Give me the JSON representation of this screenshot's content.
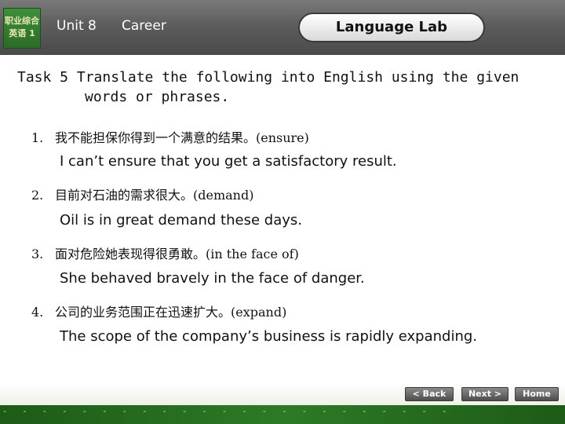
{
  "header": {
    "logo_lines": [
      "职业综合",
      "英语 1"
    ],
    "unit": "Unit 8",
    "career": "Career",
    "section": "Language Lab"
  },
  "task": {
    "line1": "Task 5 Translate the following into English using the given",
    "line2": "words or phrases."
  },
  "items": [
    {
      "num": "1.",
      "chinese": "我不能担保你得到一个满意的结果。(ensure)",
      "answer": "I can’t ensure that you get a satisfactory result."
    },
    {
      "num": "2.",
      "chinese": "目前对石油的需求很大。(demand)",
      "answer": "Oil is in great demand these days."
    },
    {
      "num": "3.",
      "chinese": "面对危险她表现得很勇敢。(in the face of)",
      "answer": "She behaved bravely in the face of danger."
    },
    {
      "num": "4.",
      "chinese": "公司的业务范围正在迅速扩大。(expand)",
      "answer": "The scope of the company’s business is rapidly expanding."
    }
  ],
  "nav": {
    "back": "< Back",
    "next": "Next >",
    "home": "Home"
  }
}
